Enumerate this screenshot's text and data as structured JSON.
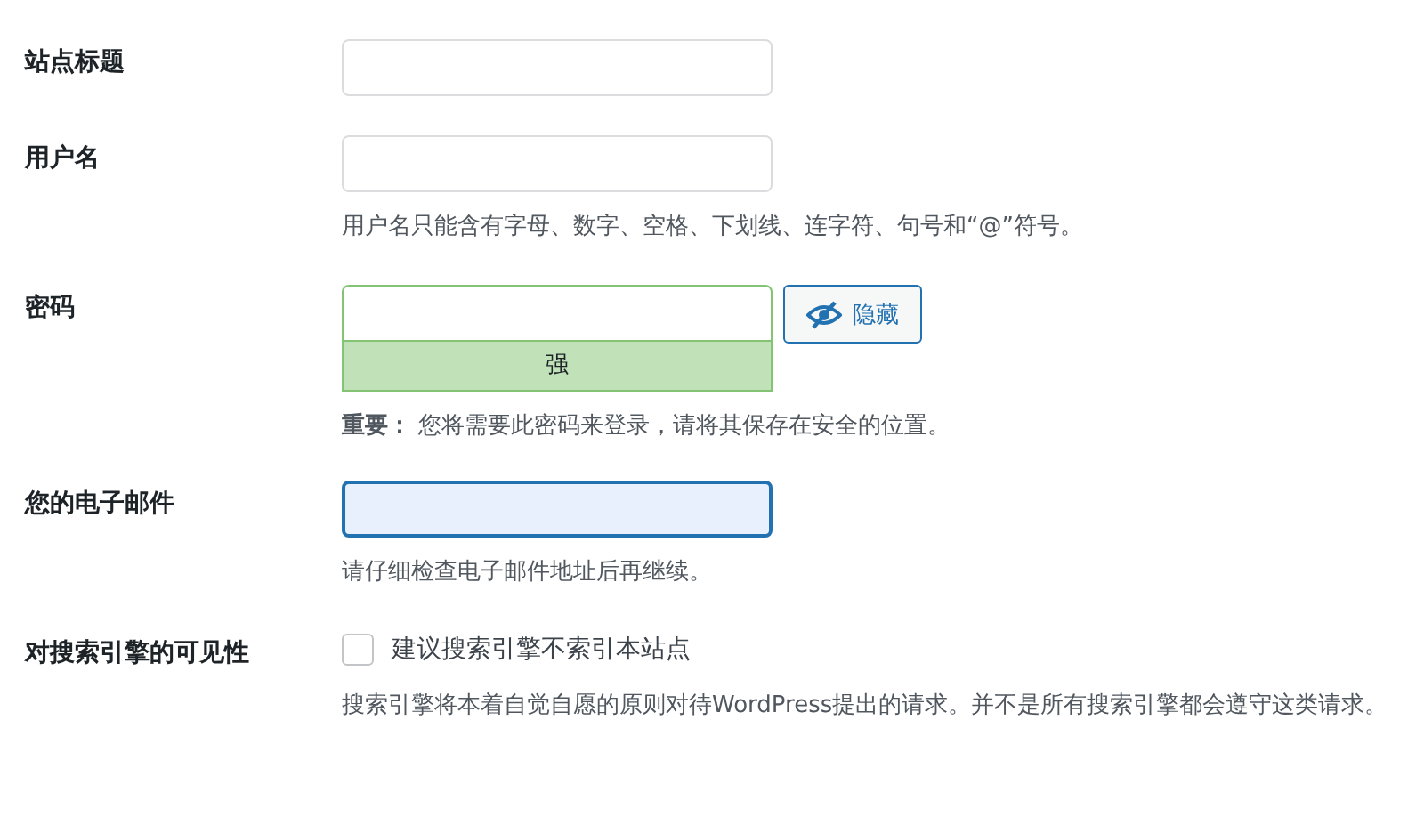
{
  "fields": [
    {
      "kind": "text",
      "label": "站点标题",
      "focused": false
    },
    {
      "kind": "text",
      "label": "用户名",
      "focused": false,
      "hint": "用户名只能含有字母、数字、空格、下划线、连字符、句号和“@”符号。"
    },
    {
      "kind": "password",
      "label": "密码",
      "focused": false,
      "strength": {
        "kind": "strong",
        "label": "强"
      },
      "toggle": "隐藏",
      "hint": "**重要：** 您将需要此密码来登录，请将其保存在安全的位置。"
    },
    {
      "kind": "text",
      "label": "您的电子邮件",
      "focused": true,
      "hint": "请仔细检查电子邮件地址后再继续。"
    },
    {
      "kind": "checkbox",
      "label": "对搜索引擎的可见性",
      "option": "建议搜索引擎不索引本站点",
      "checked": false,
      "hint": "搜索引擎将本着自觉自愿的原则对待WordPress提出的请求。并不是所有搜索引擎都会遵守这类请求。"
    }
  ]
}
